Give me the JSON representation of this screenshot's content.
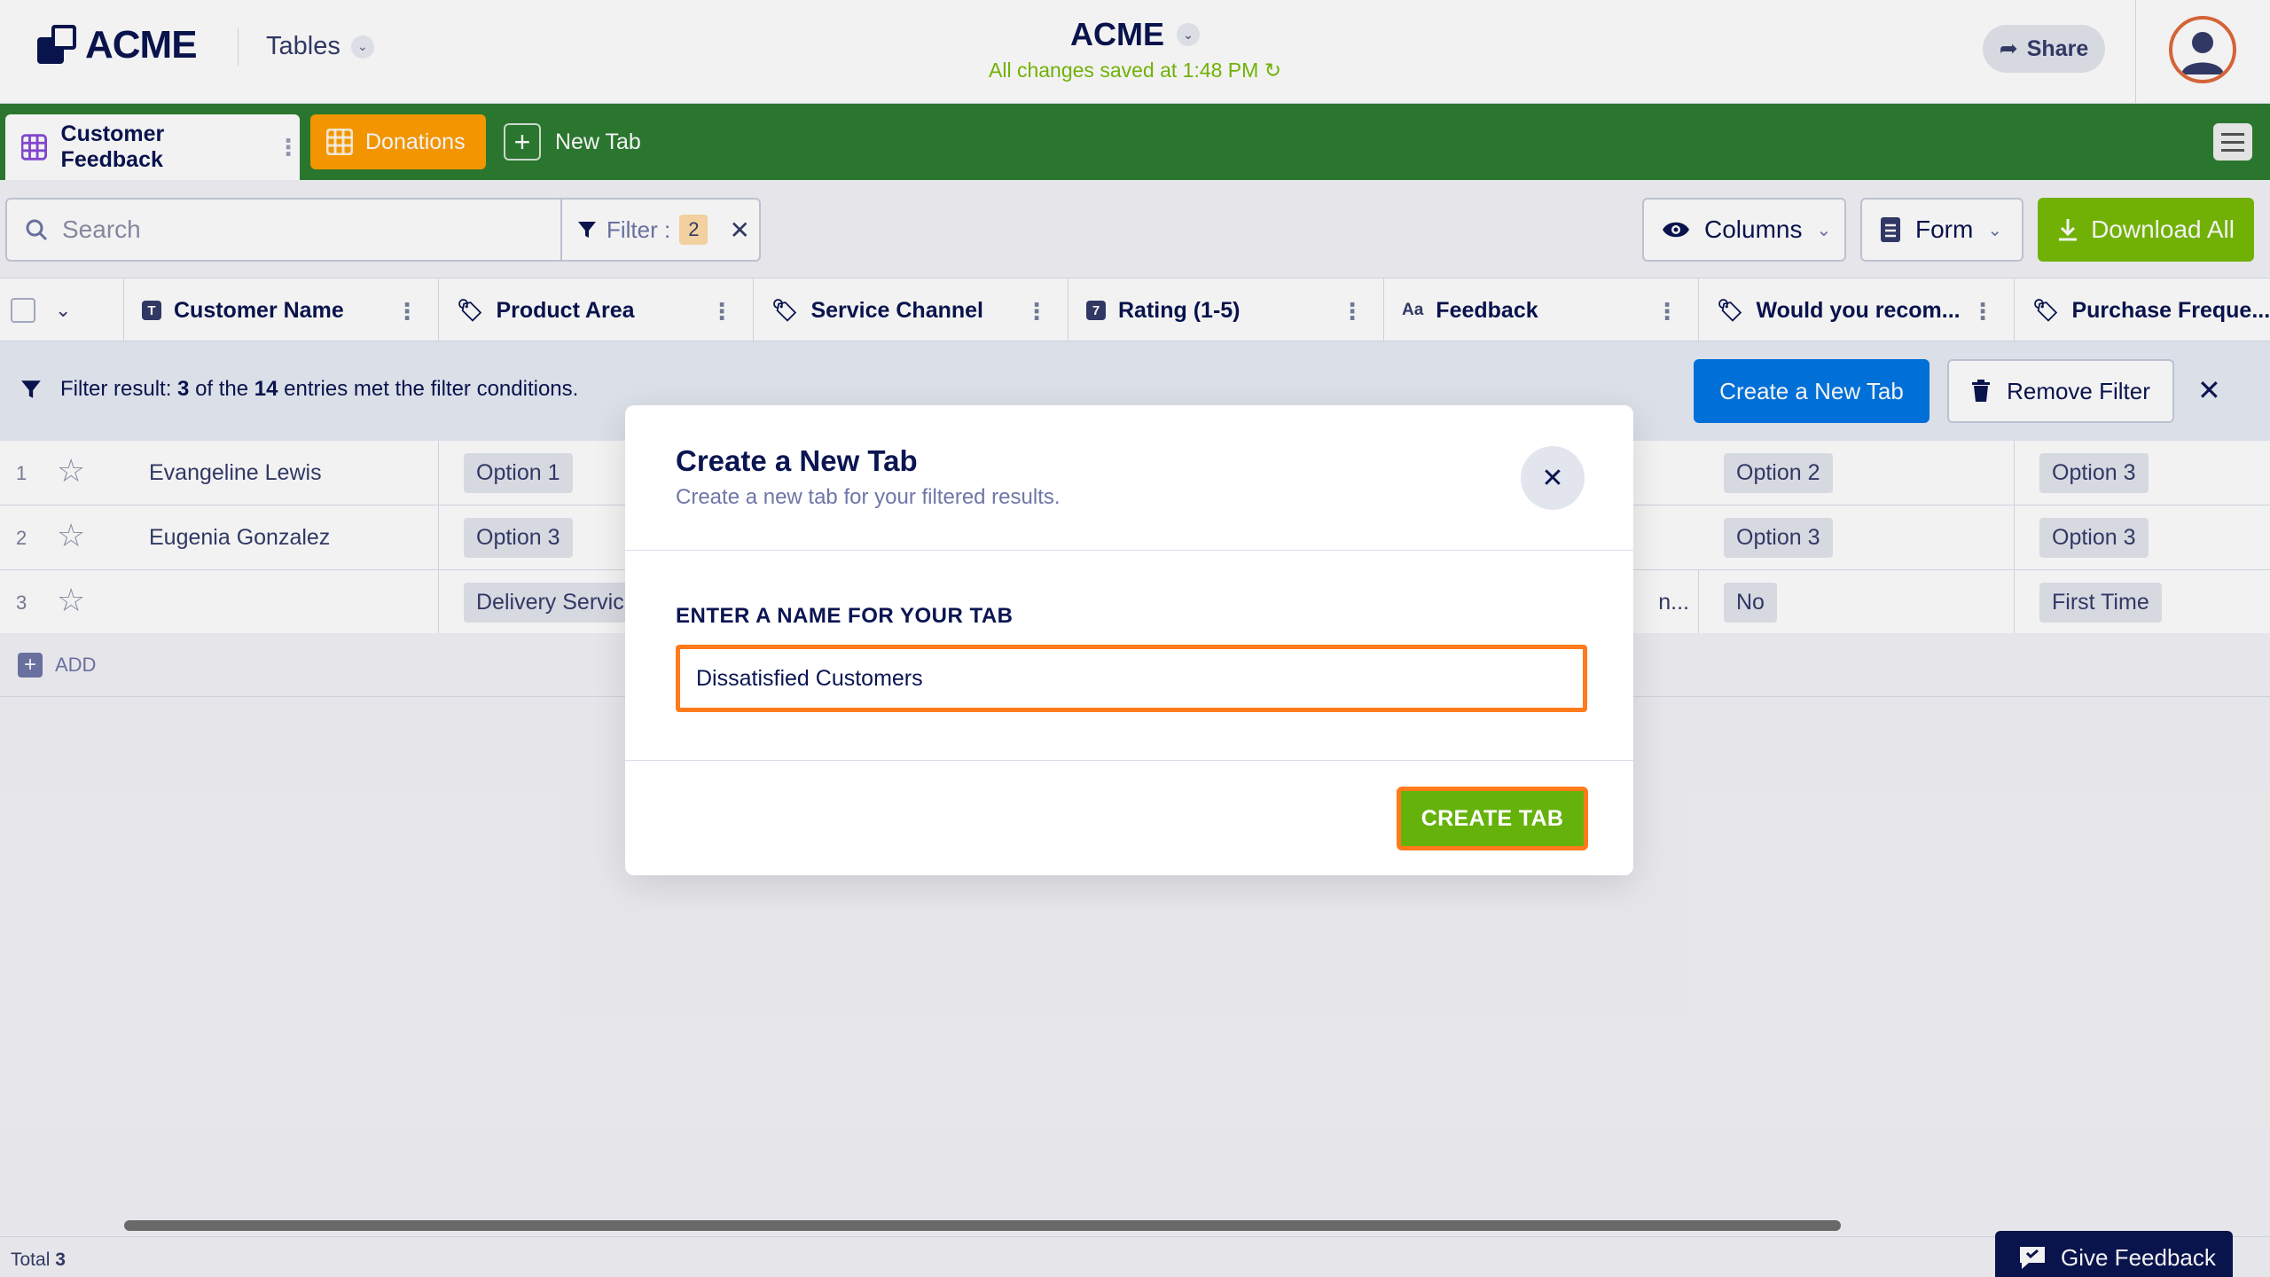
{
  "header": {
    "logo_text": "ACME",
    "tables_label": "Tables",
    "app_name": "ACME",
    "saved_status": "All changes saved at 1:48 PM",
    "share_label": "Share"
  },
  "tabs": {
    "items": [
      {
        "label": "Customer Feedback",
        "active": true
      },
      {
        "label": "Donations",
        "active": false
      }
    ],
    "new_tab_label": "New Tab"
  },
  "toolbar": {
    "search_placeholder": "Search",
    "filter_label": "Filter :",
    "filter_count": "2",
    "columns_label": "Columns",
    "form_label": "Form",
    "download_label": "Download All"
  },
  "columns": [
    {
      "label": "Customer Name",
      "icon": "text-type-icon"
    },
    {
      "label": "Product Area",
      "icon": "tag-icon"
    },
    {
      "label": "Service Channel",
      "icon": "tag-icon"
    },
    {
      "label": "Rating (1-5)",
      "icon": "number-type-icon"
    },
    {
      "label": "Feedback",
      "icon": "long-text-icon",
      "icon_text": "Aa"
    },
    {
      "label": "Would you recom...",
      "icon": "tag-icon"
    },
    {
      "label": "Purchase Freque...",
      "icon": "tag-icon"
    }
  ],
  "filter_notice": {
    "prefix": "Filter result:",
    "shown": "3",
    "middle": "of the",
    "total": "14",
    "suffix": "entries met the filter conditions.",
    "create_tab_label": "Create a New Tab",
    "remove_filter_label": "Remove Filter"
  },
  "rows": [
    {
      "num": "1",
      "name": "Evangeline Lewis",
      "product_area": "Option 1",
      "feedback_trunc": "",
      "recommend": "Option 2",
      "frequency": "Option 3"
    },
    {
      "num": "2",
      "name": "Eugenia Gonzalez",
      "product_area": "Option 3",
      "feedback_trunc": "",
      "recommend": "Option 3",
      "frequency": "Option 3"
    },
    {
      "num": "3",
      "name": "",
      "product_area": "Delivery Servic",
      "feedback_trunc": "n...",
      "recommend": "No",
      "frequency": "First Time"
    }
  ],
  "add_row_label": "ADD",
  "footer": {
    "total_label": "Total",
    "total_value": "3",
    "give_feedback_label": "Give Feedback"
  },
  "modal": {
    "title": "Create a New Tab",
    "subtitle": "Create a new tab for your filtered results.",
    "field_label": "ENTER A NAME FOR YOUR TAB",
    "field_value": "Dissatisfied Customers",
    "submit_label": "CREATE TAB"
  },
  "colors": {
    "tabbar": "#2e7d32",
    "donations_tab": "#ff9d00",
    "download_button": "#78bb07",
    "create_tab_button": "#0075e3",
    "highlight_outline": "#ff7a1a",
    "submit_button": "#64b20a",
    "navy": "#0a1551"
  }
}
